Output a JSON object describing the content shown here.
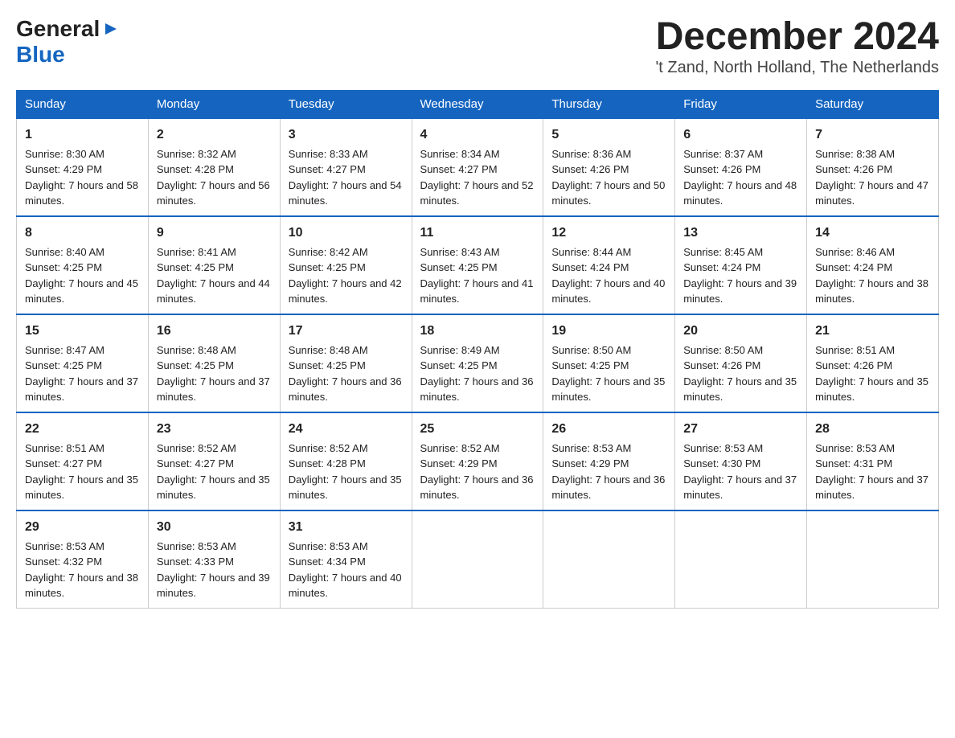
{
  "header": {
    "logo": {
      "general": "General",
      "blue": "Blue",
      "arrow": "▶"
    },
    "title": "December 2024",
    "location": "'t Zand, North Holland, The Netherlands"
  },
  "days_of_week": [
    "Sunday",
    "Monday",
    "Tuesday",
    "Wednesday",
    "Thursday",
    "Friday",
    "Saturday"
  ],
  "weeks": [
    [
      {
        "day": "1",
        "sunrise": "8:30 AM",
        "sunset": "4:29 PM",
        "daylight": "7 hours and 58 minutes."
      },
      {
        "day": "2",
        "sunrise": "8:32 AM",
        "sunset": "4:28 PM",
        "daylight": "7 hours and 56 minutes."
      },
      {
        "day": "3",
        "sunrise": "8:33 AM",
        "sunset": "4:27 PM",
        "daylight": "7 hours and 54 minutes."
      },
      {
        "day": "4",
        "sunrise": "8:34 AM",
        "sunset": "4:27 PM",
        "daylight": "7 hours and 52 minutes."
      },
      {
        "day": "5",
        "sunrise": "8:36 AM",
        "sunset": "4:26 PM",
        "daylight": "7 hours and 50 minutes."
      },
      {
        "day": "6",
        "sunrise": "8:37 AM",
        "sunset": "4:26 PM",
        "daylight": "7 hours and 48 minutes."
      },
      {
        "day": "7",
        "sunrise": "8:38 AM",
        "sunset": "4:26 PM",
        "daylight": "7 hours and 47 minutes."
      }
    ],
    [
      {
        "day": "8",
        "sunrise": "8:40 AM",
        "sunset": "4:25 PM",
        "daylight": "7 hours and 45 minutes."
      },
      {
        "day": "9",
        "sunrise": "8:41 AM",
        "sunset": "4:25 PM",
        "daylight": "7 hours and 44 minutes."
      },
      {
        "day": "10",
        "sunrise": "8:42 AM",
        "sunset": "4:25 PM",
        "daylight": "7 hours and 42 minutes."
      },
      {
        "day": "11",
        "sunrise": "8:43 AM",
        "sunset": "4:25 PM",
        "daylight": "7 hours and 41 minutes."
      },
      {
        "day": "12",
        "sunrise": "8:44 AM",
        "sunset": "4:24 PM",
        "daylight": "7 hours and 40 minutes."
      },
      {
        "day": "13",
        "sunrise": "8:45 AM",
        "sunset": "4:24 PM",
        "daylight": "7 hours and 39 minutes."
      },
      {
        "day": "14",
        "sunrise": "8:46 AM",
        "sunset": "4:24 PM",
        "daylight": "7 hours and 38 minutes."
      }
    ],
    [
      {
        "day": "15",
        "sunrise": "8:47 AM",
        "sunset": "4:25 PM",
        "daylight": "7 hours and 37 minutes."
      },
      {
        "day": "16",
        "sunrise": "8:48 AM",
        "sunset": "4:25 PM",
        "daylight": "7 hours and 37 minutes."
      },
      {
        "day": "17",
        "sunrise": "8:48 AM",
        "sunset": "4:25 PM",
        "daylight": "7 hours and 36 minutes."
      },
      {
        "day": "18",
        "sunrise": "8:49 AM",
        "sunset": "4:25 PM",
        "daylight": "7 hours and 36 minutes."
      },
      {
        "day": "19",
        "sunrise": "8:50 AM",
        "sunset": "4:25 PM",
        "daylight": "7 hours and 35 minutes."
      },
      {
        "day": "20",
        "sunrise": "8:50 AM",
        "sunset": "4:26 PM",
        "daylight": "7 hours and 35 minutes."
      },
      {
        "day": "21",
        "sunrise": "8:51 AM",
        "sunset": "4:26 PM",
        "daylight": "7 hours and 35 minutes."
      }
    ],
    [
      {
        "day": "22",
        "sunrise": "8:51 AM",
        "sunset": "4:27 PM",
        "daylight": "7 hours and 35 minutes."
      },
      {
        "day": "23",
        "sunrise": "8:52 AM",
        "sunset": "4:27 PM",
        "daylight": "7 hours and 35 minutes."
      },
      {
        "day": "24",
        "sunrise": "8:52 AM",
        "sunset": "4:28 PM",
        "daylight": "7 hours and 35 minutes."
      },
      {
        "day": "25",
        "sunrise": "8:52 AM",
        "sunset": "4:29 PM",
        "daylight": "7 hours and 36 minutes."
      },
      {
        "day": "26",
        "sunrise": "8:53 AM",
        "sunset": "4:29 PM",
        "daylight": "7 hours and 36 minutes."
      },
      {
        "day": "27",
        "sunrise": "8:53 AM",
        "sunset": "4:30 PM",
        "daylight": "7 hours and 37 minutes."
      },
      {
        "day": "28",
        "sunrise": "8:53 AM",
        "sunset": "4:31 PM",
        "daylight": "7 hours and 37 minutes."
      }
    ],
    [
      {
        "day": "29",
        "sunrise": "8:53 AM",
        "sunset": "4:32 PM",
        "daylight": "7 hours and 38 minutes."
      },
      {
        "day": "30",
        "sunrise": "8:53 AM",
        "sunset": "4:33 PM",
        "daylight": "7 hours and 39 minutes."
      },
      {
        "day": "31",
        "sunrise": "8:53 AM",
        "sunset": "4:34 PM",
        "daylight": "7 hours and 40 minutes."
      },
      null,
      null,
      null,
      null
    ]
  ]
}
